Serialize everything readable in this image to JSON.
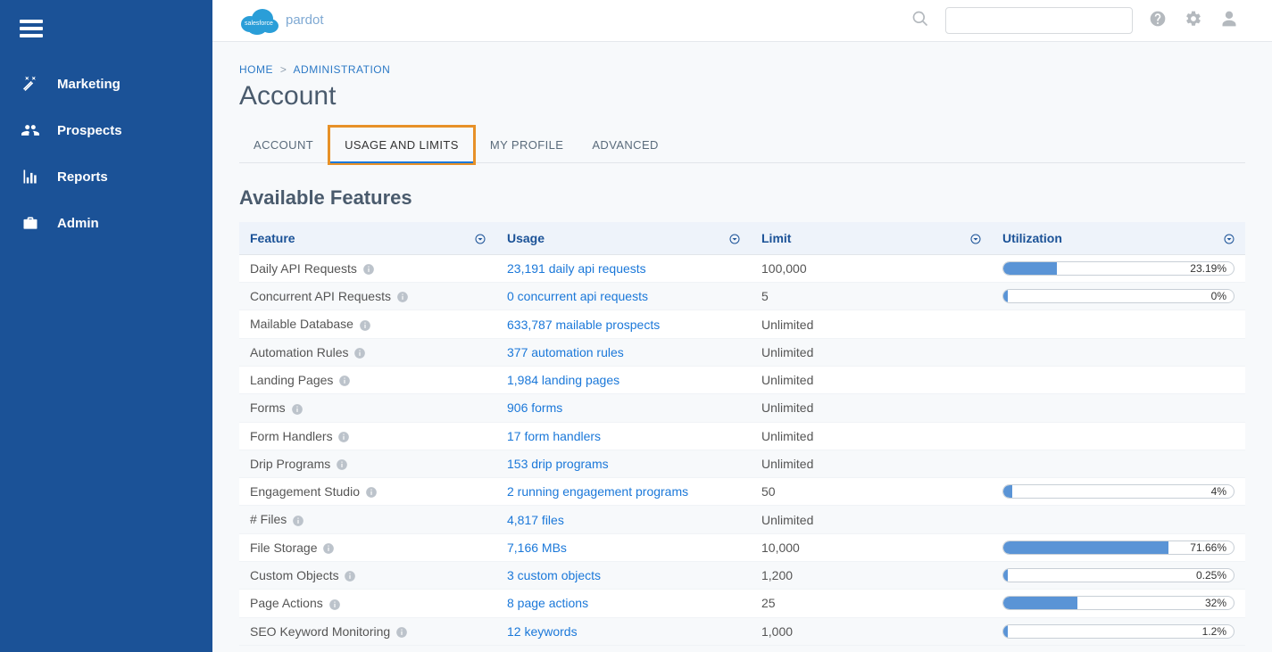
{
  "brand": {
    "name": "pardot"
  },
  "sidebar": {
    "items": [
      {
        "label": "Marketing",
        "icon": "wand"
      },
      {
        "label": "Prospects",
        "icon": "people"
      },
      {
        "label": "Reports",
        "icon": "chart"
      },
      {
        "label": "Admin",
        "icon": "briefcase"
      }
    ]
  },
  "breadcrumb": {
    "home": "HOME",
    "current": "ADMINISTRATION"
  },
  "page_title": "Account",
  "tabs": [
    {
      "label": "ACCOUNT",
      "active": false,
      "highlighted": false
    },
    {
      "label": "USAGE AND LIMITS",
      "active": true,
      "highlighted": true
    },
    {
      "label": "MY PROFILE",
      "active": false,
      "highlighted": false
    },
    {
      "label": "ADVANCED",
      "active": false,
      "highlighted": false
    }
  ],
  "section_title": "Available Features",
  "table": {
    "headers": {
      "feature": "Feature",
      "usage": "Usage",
      "limit": "Limit",
      "utilization": "Utilization"
    },
    "rows": [
      {
        "feature": "Daily API Requests",
        "usage": "23,191 daily api requests",
        "limit": "100,000",
        "utilization": 23.19,
        "util_label": "23.19%"
      },
      {
        "feature": "Concurrent API Requests",
        "usage": "0 concurrent api requests",
        "limit": "5",
        "utilization": 0,
        "util_label": "0%"
      },
      {
        "feature": "Mailable Database",
        "usage": "633,787 mailable prospects",
        "limit": "Unlimited",
        "utilization": null,
        "util_label": ""
      },
      {
        "feature": "Automation Rules",
        "usage": "377 automation rules",
        "limit": "Unlimited",
        "utilization": null,
        "util_label": ""
      },
      {
        "feature": "Landing Pages",
        "usage": "1,984 landing pages",
        "limit": "Unlimited",
        "utilization": null,
        "util_label": ""
      },
      {
        "feature": "Forms",
        "usage": "906 forms",
        "limit": "Unlimited",
        "utilization": null,
        "util_label": ""
      },
      {
        "feature": "Form Handlers",
        "usage": "17 form handlers",
        "limit": "Unlimited",
        "utilization": null,
        "util_label": ""
      },
      {
        "feature": "Drip Programs",
        "usage": "153 drip programs",
        "limit": "Unlimited",
        "utilization": null,
        "util_label": ""
      },
      {
        "feature": "Engagement Studio",
        "usage": "2 running engagement programs",
        "limit": "50",
        "utilization": 4,
        "util_label": "4%"
      },
      {
        "feature": "# Files",
        "usage": "4,817 files",
        "limit": "Unlimited",
        "utilization": null,
        "util_label": ""
      },
      {
        "feature": "File Storage",
        "usage": "7,166 MBs",
        "limit": "10,000",
        "utilization": 71.66,
        "util_label": "71.66%"
      },
      {
        "feature": "Custom Objects",
        "usage": "3 custom objects",
        "limit": "1,200",
        "utilization": 0.25,
        "util_label": "0.25%"
      },
      {
        "feature": "Page Actions",
        "usage": "8 page actions",
        "limit": "25",
        "utilization": 32,
        "util_label": "32%"
      },
      {
        "feature": "SEO Keyword Monitoring",
        "usage": "12 keywords",
        "limit": "1,000",
        "utilization": 1.2,
        "util_label": "1.2%"
      }
    ]
  }
}
